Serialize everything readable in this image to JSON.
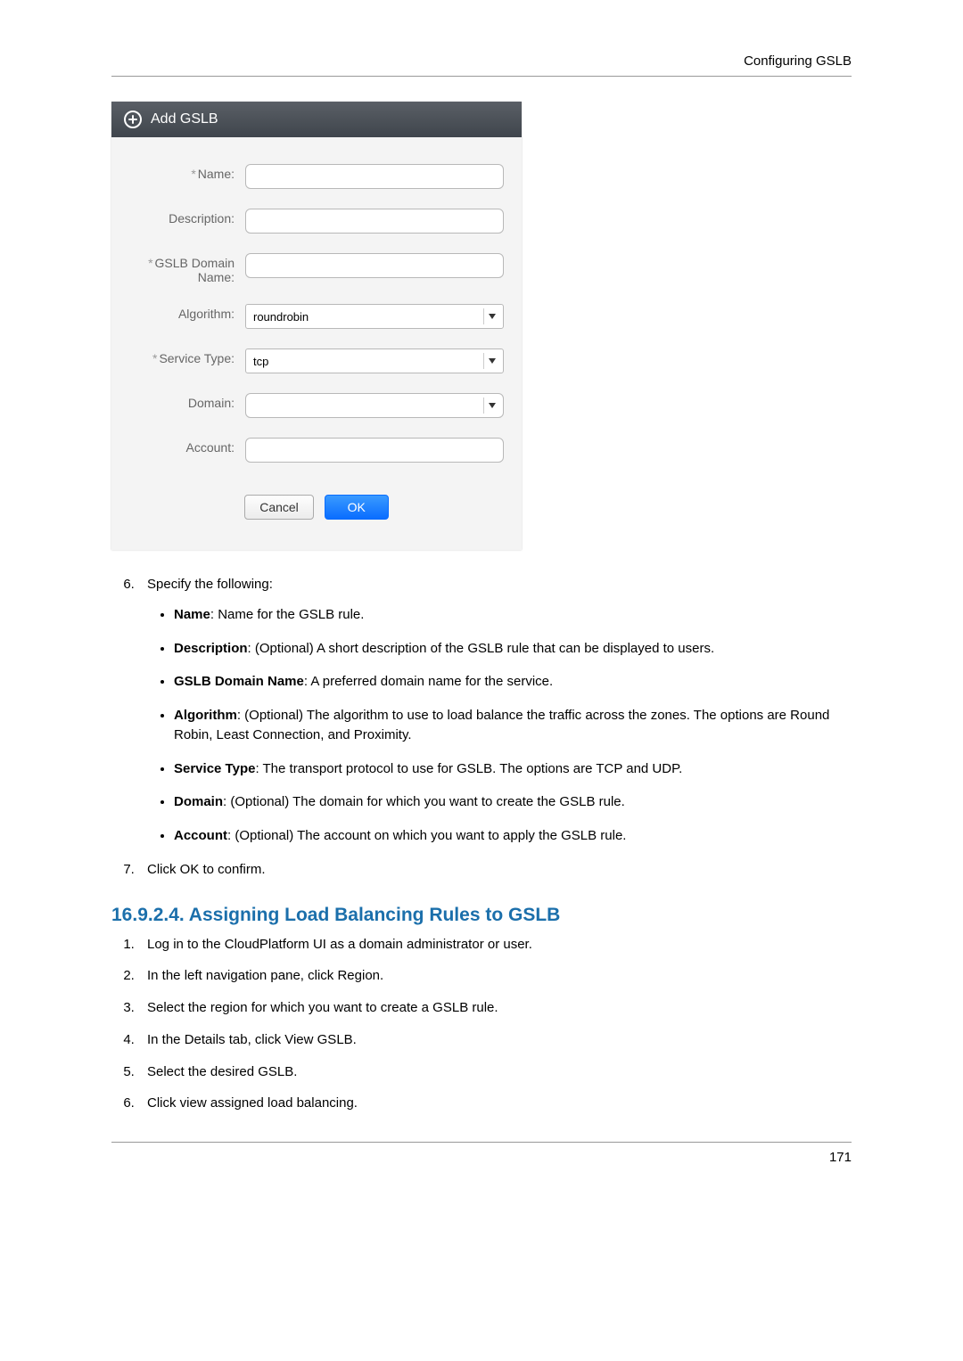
{
  "header": {
    "title": "Configuring GSLB"
  },
  "dialog": {
    "title": "Add GSLB",
    "fields": {
      "name": {
        "label": "Name:",
        "required": true,
        "value": ""
      },
      "description": {
        "label": "Description:",
        "required": false,
        "value": ""
      },
      "gslb_domain": {
        "label": "GSLB Domain Name:",
        "required": true,
        "value": ""
      },
      "algorithm": {
        "label": "Algorithm:",
        "required": false,
        "value": "roundrobin"
      },
      "service_type": {
        "label": "Service Type:",
        "required": true,
        "value": "tcp"
      },
      "domain": {
        "label": "Domain:",
        "required": false,
        "value": ""
      },
      "account": {
        "label": "Account:",
        "required": false,
        "value": ""
      }
    },
    "actions": {
      "cancel": "Cancel",
      "ok": "OK"
    }
  },
  "doc": {
    "step6_intro": "Specify the following:",
    "bullets": {
      "name": {
        "term": "Name",
        "desc": ": Name for the GSLB rule."
      },
      "description": {
        "term": "Description",
        "desc": ": (Optional) A short description of the GSLB rule that can be displayed to users."
      },
      "gslb_domain": {
        "term": "GSLB Domain Name",
        "desc": ": A preferred domain name for the service."
      },
      "algorithm": {
        "term": "Algorithm",
        "desc": ": (Optional) The algorithm to use to load balance the traffic across the zones. The options are Round Robin, Least Connection, and Proximity."
      },
      "service_type": {
        "term": "Service Type",
        "desc": ": The transport protocol to use for GSLB. The options are TCP and UDP."
      },
      "domain": {
        "term": "Domain",
        "desc": ": (Optional) The domain for which you want to create the GSLB rule."
      },
      "account": {
        "term": "Account",
        "desc": ": (Optional) The account on which you want to apply the GSLB rule."
      }
    },
    "step7": "Click OK to confirm.",
    "section_heading": "16.9.2.4. Assigning Load Balancing Rules to GSLB",
    "steps2": {
      "s1": "Log in to the CloudPlatform UI as a domain administrator or user.",
      "s2": "In the left navigation pane, click Region.",
      "s3": "Select the region for which you want to create a GSLB rule.",
      "s4": "In the Details tab, click View GSLB.",
      "s5": "Select the desired GSLB.",
      "s6": "Click view assigned load balancing."
    }
  },
  "footer": {
    "page_number": "171"
  }
}
